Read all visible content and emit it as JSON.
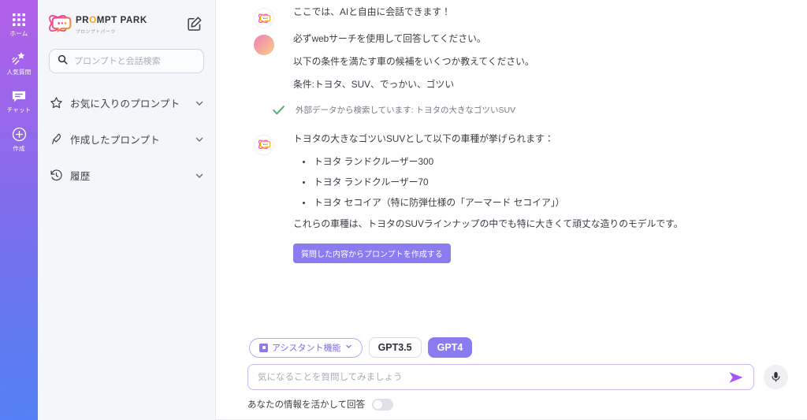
{
  "rail": {
    "items": [
      {
        "label": "ホーム",
        "icon": "grid-icon"
      },
      {
        "label": "人気質問",
        "icon": "shooting-star-icon"
      },
      {
        "label": "チャット",
        "icon": "chat-bubble-icon"
      },
      {
        "label": "作成",
        "icon": "plus-circle-icon"
      }
    ],
    "avatar": "user-avatar",
    "gradient_top": "#b260e8",
    "gradient_bottom": "#5580f5"
  },
  "sidebar": {
    "brand": {
      "title_before": "PR",
      "title_accent": "O",
      "title_after": "MPT PARK",
      "subtitle": "プロンプトパーク",
      "accent_color": "#f5a31f"
    },
    "compose_icon": "compose-edit-icon",
    "search": {
      "placeholder": "プロンプトと会話検索",
      "value": "",
      "icon": "search-icon"
    },
    "nav": [
      {
        "label": "お気に入りのプロンプト",
        "icon": "star-icon",
        "chevron": "chevron-down-icon"
      },
      {
        "label": "作成したプロンプト",
        "icon": "feather-pen-icon",
        "chevron": "chevron-down-icon"
      },
      {
        "label": "履歴",
        "icon": "history-clock-icon",
        "chevron": "chevron-down-icon"
      }
    ]
  },
  "thread": {
    "intro": {
      "text": "ここでは、AIと自由に会話できます！",
      "avatar": "bot-avatar"
    },
    "user": {
      "avatar": "user-avatar",
      "lines": [
        "必ずwebサーチを使用して回答してください。",
        "以下の条件を満たす車の候補をいくつか教えてください。",
        "条件:トヨタ、SUV、でっかい、ゴツい"
      ]
    },
    "status": {
      "icon": "green-check-icon",
      "text": "外部データから検索しています: トヨタの大きなゴツいSUV",
      "color": "#4caf72"
    },
    "answer": {
      "avatar": "bot-avatar",
      "intro": "トヨタの大きなゴツいSUVとして以下の車種が挙げられます：",
      "bullets": [
        "トヨタ ランドクルーザー300",
        "トヨタ ランドクルーザー70",
        "トヨタ セコイア（特に防弾仕様の「アーマード セコイア」）"
      ],
      "outro": "これらの車種は、トヨタのSUVラインナップの中でも特に大きくて頑丈な造りのモデルです。",
      "cta_label": "質問した内容からプロンプトを作成する"
    }
  },
  "composer": {
    "assistant_chip": {
      "label": "アシスタント機能",
      "icon": "assistant-icon",
      "chevron": "chevron-down-icon"
    },
    "models": [
      {
        "label": "GPT3.5",
        "active": false
      },
      {
        "label": "GPT4",
        "active": true
      }
    ],
    "input": {
      "placeholder": "気になることを質問してみましょう",
      "value": ""
    },
    "send_icon": "send-arrow-icon",
    "mic_icon": "microphone-icon",
    "toggle": {
      "label": "あなたの情報を活かして回答",
      "on": false
    },
    "accent_color": "#8b7bf0"
  }
}
